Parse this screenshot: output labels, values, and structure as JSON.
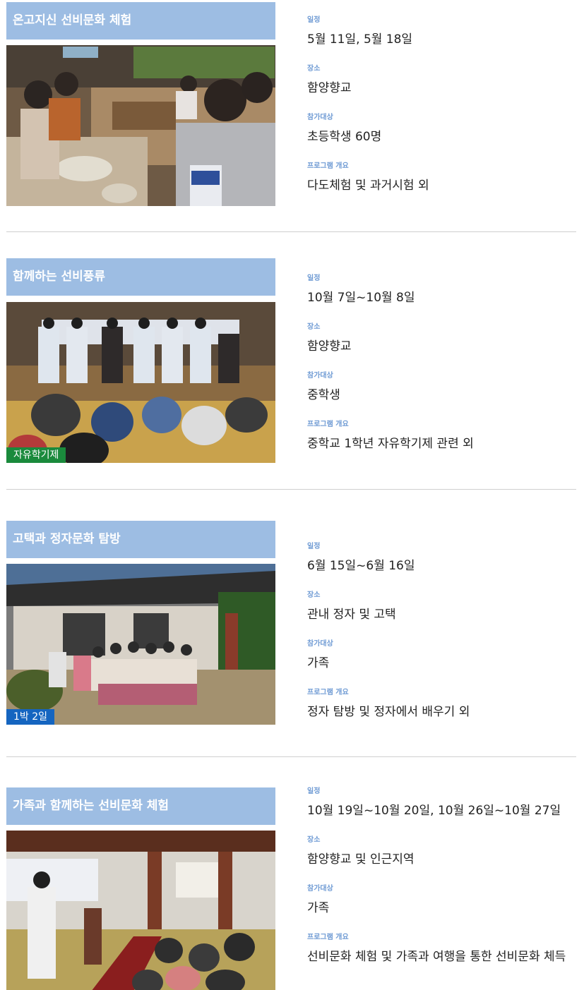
{
  "labels": {
    "schedule": "일정",
    "place": "장소",
    "target": "참가대상",
    "overview": "프로그램 개요"
  },
  "programs": [
    {
      "title": "온고지신 선비문화 체험",
      "badge": "",
      "schedule": "5월 11일, 5월 18일",
      "place": "함양향교",
      "target": "초등학생 60명",
      "overview": "다도체험 및 과거시험 외"
    },
    {
      "title": "함께하는 선비풍류",
      "badge": "자유학기제",
      "badge_color": "#1a8a3c",
      "schedule": "10월 7일~10월 8일",
      "place": "함양향교",
      "target": "중학생",
      "overview": "중학교 1학년 자유학기제 관련 외"
    },
    {
      "title": "고택과 정자문화 탐방",
      "badge": "1박 2일",
      "badge_color": "#1565c0",
      "schedule": "6월 15일~6월 16일",
      "place": "관내 정자 및 고택",
      "target": "가족",
      "overview": "정자 탐방 및 정자에서 배우기 외"
    },
    {
      "title": "가족과 함께하는 선비문화 체험",
      "badge": "",
      "schedule": "10월 19일~10월 20일, 10월 26일~10월 27일",
      "place": "함양향교 및 인근지역",
      "target": "가족",
      "overview": "선비문화 체험 및 가족과 여행을 통한 선비문화 체득"
    }
  ],
  "colors": {
    "title_bar": "#9dbde3",
    "label": "#6f9bd4",
    "divider": "#cfcfcf"
  }
}
